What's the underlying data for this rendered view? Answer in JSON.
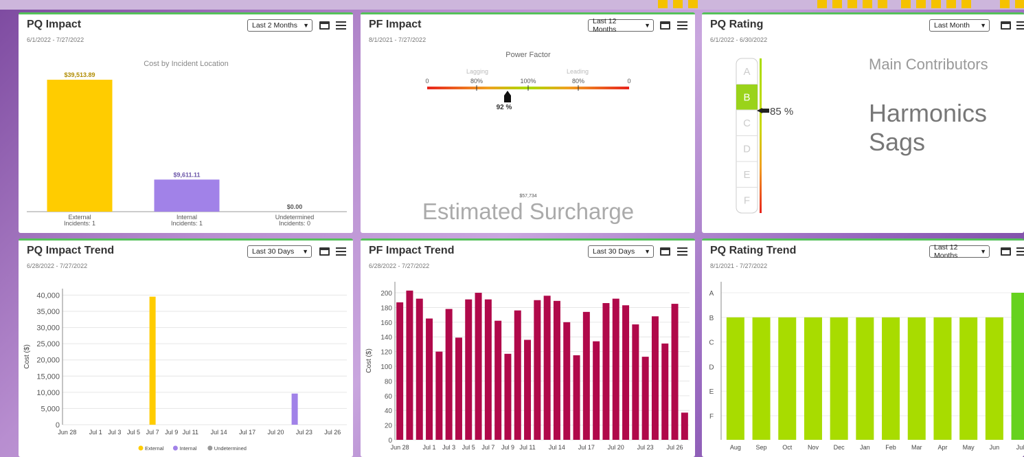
{
  "panels": {
    "pq_impact": {
      "title": "PQ Impact",
      "date_range": "6/1/2022 - 7/27/2022",
      "range_select": "Last 2 Months",
      "chart_title": "Cost by Incident Location"
    },
    "pf_impact": {
      "title": "PF Impact",
      "date_range": "8/1/2021 - 7/27/2022",
      "range_select": "Last 12 Months",
      "gauge_title": "Power Factor",
      "lagging_label": "Lagging",
      "leading_label": "Leading",
      "gauge_ticks": [
        "0",
        "80%",
        "100%",
        "80%",
        "0"
      ],
      "pf_value": 92,
      "pf_value_label": "92 %",
      "surcharge_value": "$57,734",
      "surcharge_label": "Estimated Surcharge"
    },
    "pq_rating": {
      "title": "PQ Rating",
      "date_range": "6/1/2022 - 6/30/2022",
      "range_select": "Last Month",
      "grades": [
        "A",
        "B",
        "C",
        "D",
        "E",
        "F"
      ],
      "current_grade": "B",
      "rating_label": "85 %",
      "rating_value": 85,
      "contributors_heading": "Main Contributors",
      "contributors": [
        "Harmonics",
        "Sags"
      ]
    },
    "pq_impact_trend": {
      "title": "PQ Impact Trend",
      "date_range": "6/28/2022 - 7/27/2022",
      "range_select": "Last 30 Days"
    },
    "pf_impact_trend": {
      "title": "PF Impact Trend",
      "date_range": "6/28/2022 - 7/27/2022",
      "range_select": "Last 30 Days"
    },
    "pq_rating_trend": {
      "title": "PQ Rating Trend",
      "date_range": "8/1/2021 - 7/27/2022",
      "range_select": "Last 12 Months"
    }
  },
  "colors": {
    "external": "#ffcc00",
    "internal": "#a182e8",
    "undetermined": "#999999",
    "pf_bar": "#b0094a",
    "rating_bar": "#a8dc00",
    "rating_bar_current": "#66d21e",
    "panel_border": "#55c15a"
  },
  "chart_data": [
    {
      "type": "bar",
      "title": "Cost by Incident Location",
      "categories": [
        "External\nIncidents: 1",
        "Internal\nIncidents: 1",
        "Undetermined\nIncidents: 0"
      ],
      "values": [
        39513.89,
        9611.11,
        0
      ],
      "value_labels": [
        "$39,513.89",
        "$9,611.11",
        "$0.00"
      ],
      "ylim": [
        0,
        42000
      ]
    },
    {
      "type": "bar",
      "title": "",
      "xlabel": "",
      "ylabel": "Cost ($)",
      "x_tick_labels": [
        "Jun 28",
        "Jul 1",
        "Jul 3",
        "Jul 5",
        "Jul 7",
        "Jul 9",
        "Jul 11",
        "Jul 14",
        "Jul 17",
        "Jul 20",
        "Jul 23",
        "Jul 26"
      ],
      "y_tick_labels": [
        "0",
        "5,000",
        "10,000",
        "15,000",
        "20,000",
        "25,000",
        "30,000",
        "35,000",
        "40,000"
      ],
      "ylim": [
        0,
        42000
      ],
      "days": [
        "Jun 28",
        "Jun 29",
        "Jun 30",
        "Jul 1",
        "Jul 2",
        "Jul 3",
        "Jul 4",
        "Jul 5",
        "Jul 6",
        "Jul 7",
        "Jul 8",
        "Jul 9",
        "Jul 10",
        "Jul 11",
        "Jul 12",
        "Jul 13",
        "Jul 14",
        "Jul 15",
        "Jul 16",
        "Jul 17",
        "Jul 18",
        "Jul 19",
        "Jul 20",
        "Jul 21",
        "Jul 22",
        "Jul 23",
        "Jul 24",
        "Jul 25",
        "Jul 26",
        "Jul 27"
      ],
      "series": [
        {
          "name": "External",
          "day": "Jul 7",
          "value": 39514
        },
        {
          "name": "Internal",
          "day": "Jul 22",
          "value": 9611
        },
        {
          "name": "Undetermined",
          "day": null,
          "value": 0
        }
      ],
      "legend": [
        "External",
        "Internal",
        "Undetermined"
      ]
    },
    {
      "type": "bar",
      "title": "",
      "ylabel": "Cost ($)",
      "x_tick_labels": [
        "Jun 28",
        "Jul 1",
        "Jul 3",
        "Jul 5",
        "Jul 7",
        "Jul 9",
        "Jul 11",
        "Jul 14",
        "Jul 17",
        "Jul 20",
        "Jul 23",
        "Jul 26"
      ],
      "y_tick_labels": [
        "0",
        "20",
        "40",
        "60",
        "80",
        "100",
        "120",
        "140",
        "160",
        "180",
        "200"
      ],
      "ylim": [
        0,
        215
      ],
      "values": [
        187,
        203,
        192,
        165,
        120,
        178,
        139,
        191,
        200,
        191,
        162,
        117,
        176,
        136,
        190,
        196,
        189,
        160,
        115,
        174,
        134,
        186,
        192,
        183,
        157,
        113,
        168,
        131,
        185,
        37
      ]
    },
    {
      "type": "bar",
      "title": "",
      "categories": [
        "Aug",
        "Sep",
        "Oct",
        "Nov",
        "Dec",
        "Jan",
        "Feb",
        "Mar",
        "Apr",
        "May",
        "Jun",
        "Jul"
      ],
      "y_tick_labels": [
        "A",
        "B",
        "C",
        "D",
        "E",
        "F"
      ],
      "values": [
        "B",
        "B",
        "B",
        "B",
        "B",
        "B",
        "B",
        "B",
        "B",
        "B",
        "B",
        "A"
      ]
    }
  ]
}
